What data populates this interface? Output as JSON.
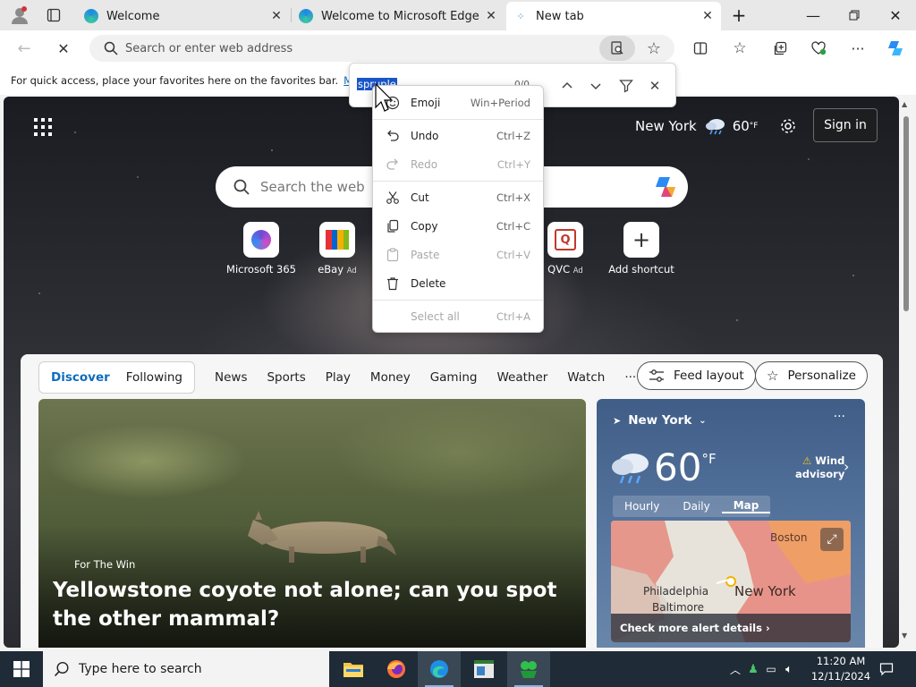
{
  "tabs": [
    {
      "title": "Welcome",
      "active": false
    },
    {
      "title": "Welcome to Microsoft Edge",
      "active": false
    },
    {
      "title": "New tab",
      "active": true
    }
  ],
  "toolbar": {
    "address_placeholder": "Search or enter web address"
  },
  "favorites_bar": {
    "hint": "For quick access, place your favorites here on the favorites bar.",
    "link": "Mana"
  },
  "find_bar": {
    "query": "spruple",
    "count": "0/0"
  },
  "context_menu": {
    "items": [
      {
        "icon": "emoji-icon",
        "label": "Emoji",
        "shortcut": "Win+Period",
        "enabled": true
      },
      {
        "icon": "undo-icon",
        "label": "Undo",
        "shortcut": "Ctrl+Z",
        "enabled": true
      },
      {
        "icon": "redo-icon",
        "label": "Redo",
        "shortcut": "Ctrl+Y",
        "enabled": false
      },
      {
        "icon": "cut-icon",
        "label": "Cut",
        "shortcut": "Ctrl+X",
        "enabled": true
      },
      {
        "icon": "copy-icon",
        "label": "Copy",
        "shortcut": "Ctrl+C",
        "enabled": true
      },
      {
        "icon": "paste-icon",
        "label": "Paste",
        "shortcut": "Ctrl+V",
        "enabled": false
      },
      {
        "icon": "delete-icon",
        "label": "Delete",
        "shortcut": "",
        "enabled": true
      },
      {
        "icon": "",
        "label": "Select all",
        "shortcut": "Ctrl+A",
        "enabled": false
      }
    ]
  },
  "newtab": {
    "weather_city": "New York",
    "weather_temp": "60",
    "weather_unit": "°F",
    "sign_in": "Sign in",
    "search_placeholder": "Search the web",
    "shortcuts": [
      {
        "label": "Microsoft 365",
        "ad": ""
      },
      {
        "label": "eBay",
        "ad": "Ad"
      },
      {
        "label": "QVC",
        "ad": "Ad"
      },
      {
        "label": "Add shortcut",
        "ad": ""
      }
    ]
  },
  "feed": {
    "tabs": [
      "Discover",
      "Following"
    ],
    "nav": [
      "News",
      "Sports",
      "Play",
      "Money",
      "Gaming",
      "Weather",
      "Watch",
      "···"
    ],
    "feed_layout": "Feed layout",
    "personalize": "Personalize",
    "hero": {
      "source": "For The Win",
      "title": "Yellowstone coyote not alone; can you spot the other mammal?"
    }
  },
  "weather_card": {
    "location": "New York",
    "more": "···",
    "temp": "60",
    "unit": "°F",
    "alert_line1": "Wind",
    "alert_line2": "advisory",
    "tabs": [
      "Hourly",
      "Daily",
      "Map"
    ],
    "map_labels": [
      "Boston",
      "Philadelphia",
      "New York",
      "Baltimore"
    ],
    "footer": "Check more alert details"
  },
  "taskbar": {
    "search_placeholder": "Type here to search",
    "time": "11:20 AM",
    "date": "12/11/2024"
  },
  "colors": {
    "accent": "#0f6cbd",
    "taskbar": "#1f2b37",
    "selection": "#1a56c9"
  }
}
